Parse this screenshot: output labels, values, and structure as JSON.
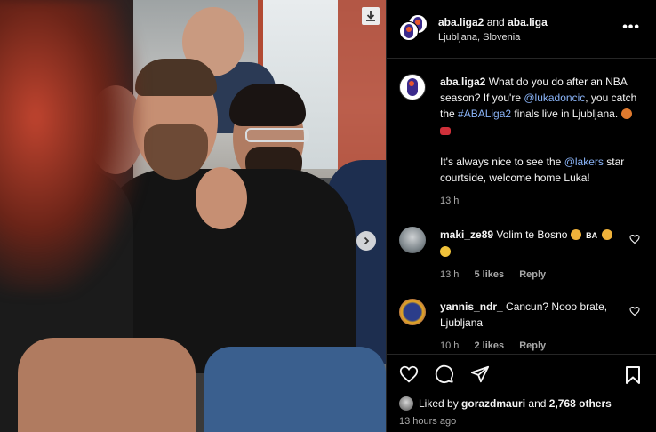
{
  "header": {
    "author_1": "aba.liga2",
    "joiner": "and",
    "author_2": "aba.liga",
    "location": "Ljubljana, Slovenia",
    "more_label": "•••"
  },
  "caption": {
    "username": "aba.liga2",
    "text_1": "What do you do after an NBA season? If you're",
    "mention_1": "@lukadoncic",
    "text_2": ", you catch the",
    "hashtag": "#ABALiga2",
    "text_3": "finals live in Ljubljana.",
    "text_4": "It's always nice to see the",
    "mention_2": "@lakers",
    "text_5": "star courtside, welcome home Luka!",
    "time": "13 h"
  },
  "comments": [
    {
      "username": "maki_ze89",
      "text": "Volim te Bosno",
      "flag": "BA",
      "time": "13 h",
      "likes": "5 likes",
      "reply": "Reply"
    },
    {
      "username": "yannis_ndr_",
      "text": "Cancun? Nooo brate, Ljubljana",
      "time": "10 h",
      "likes": "2 likes",
      "reply": "Reply"
    }
  ],
  "footer": {
    "liked_by_prefix": "Liked by",
    "liked_by_user": "gorazdmauri",
    "liked_by_and": "and",
    "liked_by_others": "2,768 others",
    "post_time": "13 hours ago"
  },
  "icons": {
    "save_photo": "download-icon",
    "next": "chevron-right-icon",
    "like": "heart-icon",
    "comment": "comment-icon",
    "share": "send-icon",
    "save": "bookmark-icon"
  },
  "colors": {
    "background": "#000000",
    "link": "#8ab4f8",
    "muted": "#a8a8a8"
  }
}
